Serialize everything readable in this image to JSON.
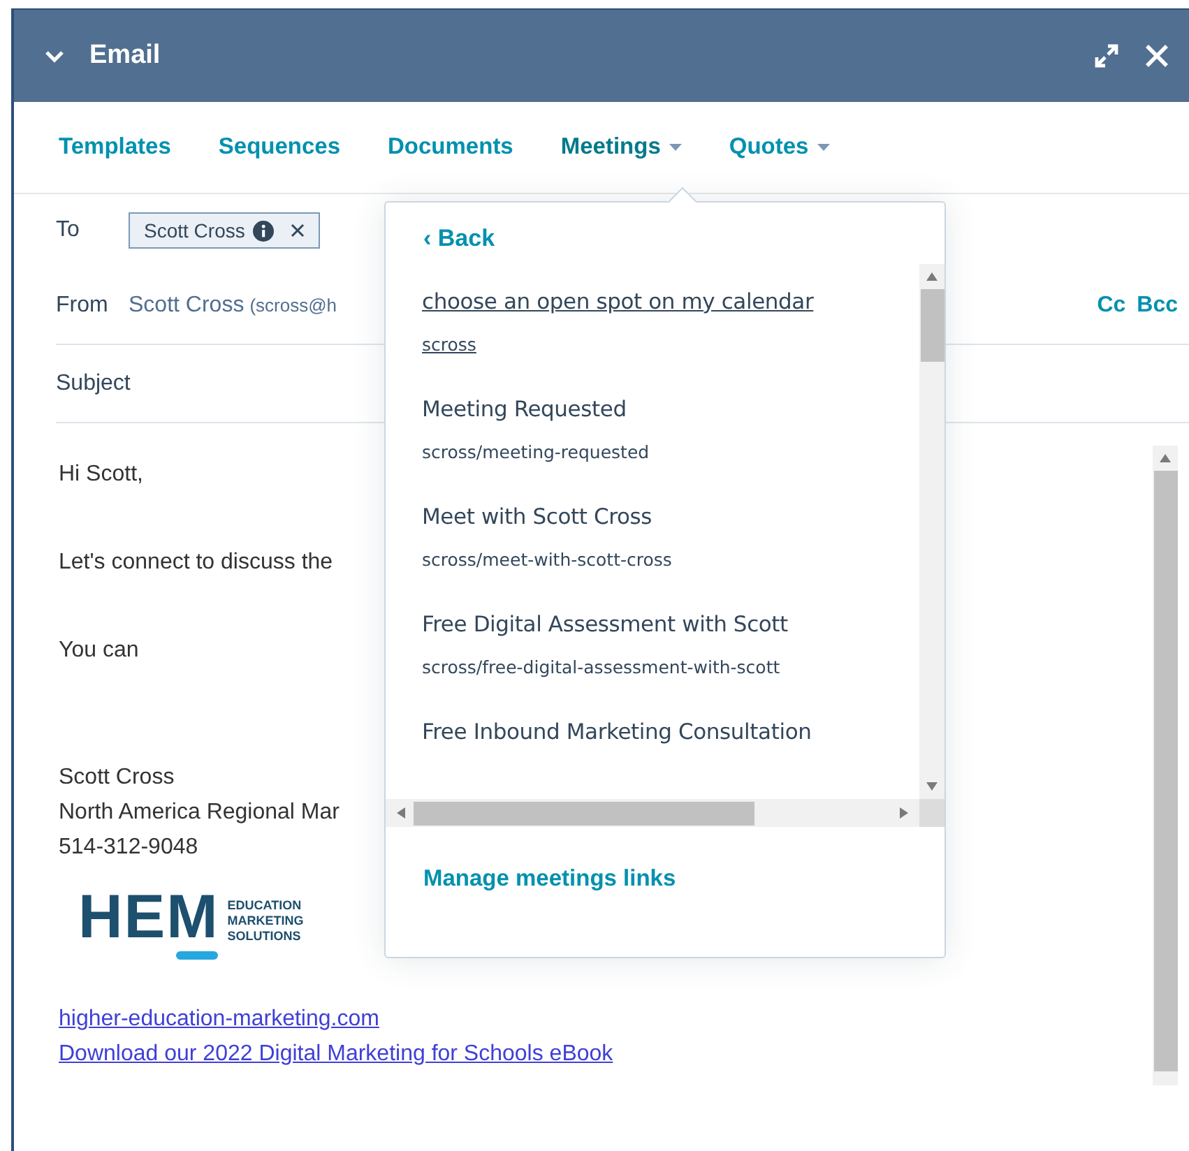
{
  "window": {
    "title": "Email"
  },
  "tabs": [
    {
      "label": "Templates",
      "dropdown": false,
      "expanded": false
    },
    {
      "label": "Sequences",
      "dropdown": false,
      "expanded": false
    },
    {
      "label": "Documents",
      "dropdown": false,
      "expanded": false
    },
    {
      "label": "Meetings",
      "dropdown": true,
      "expanded": true
    },
    {
      "label": "Quotes",
      "dropdown": true,
      "expanded": false
    }
  ],
  "to": {
    "label": "To",
    "recipient": "Scott Cross"
  },
  "from": {
    "label": "From",
    "name": "Scott Cross",
    "address": "(scross@h"
  },
  "cc": "Cc",
  "bcc": "Bcc",
  "subject": {
    "placeholder": "Subject"
  },
  "body": {
    "paragraphs": [
      "Hi Scott,",
      "Let's connect to discuss the",
      "You can"
    ],
    "signature": [
      "Scott Cross",
      "North America Regional Mar",
      "514-312-9048"
    ],
    "logo": {
      "mark": "HEM",
      "words": [
        "EDUCATION",
        "MARKETING",
        "SOLUTIONS"
      ]
    },
    "links": [
      "higher-education-marketing.com",
      "Download our 2022 Digital Marketing for Schools eBook"
    ]
  },
  "meetings_menu": {
    "back": "‹ Back",
    "items": [
      {
        "title": "choose an open spot on my calendar",
        "slug": "scross",
        "hovered": true
      },
      {
        "title": "Meeting Requested",
        "slug": "scross/meeting-requested",
        "hovered": false
      },
      {
        "title": "Meet with Scott Cross",
        "slug": "scross/meet-with-scott-cross",
        "hovered": false
      },
      {
        "title": "Free Digital Assessment with Scott",
        "slug": "scross/free-digital-assessment-with-scott",
        "hovered": false
      },
      {
        "title": "Free Inbound Marketing Consultation",
        "hovered": false
      }
    ],
    "footer": "Manage meetings links"
  }
}
